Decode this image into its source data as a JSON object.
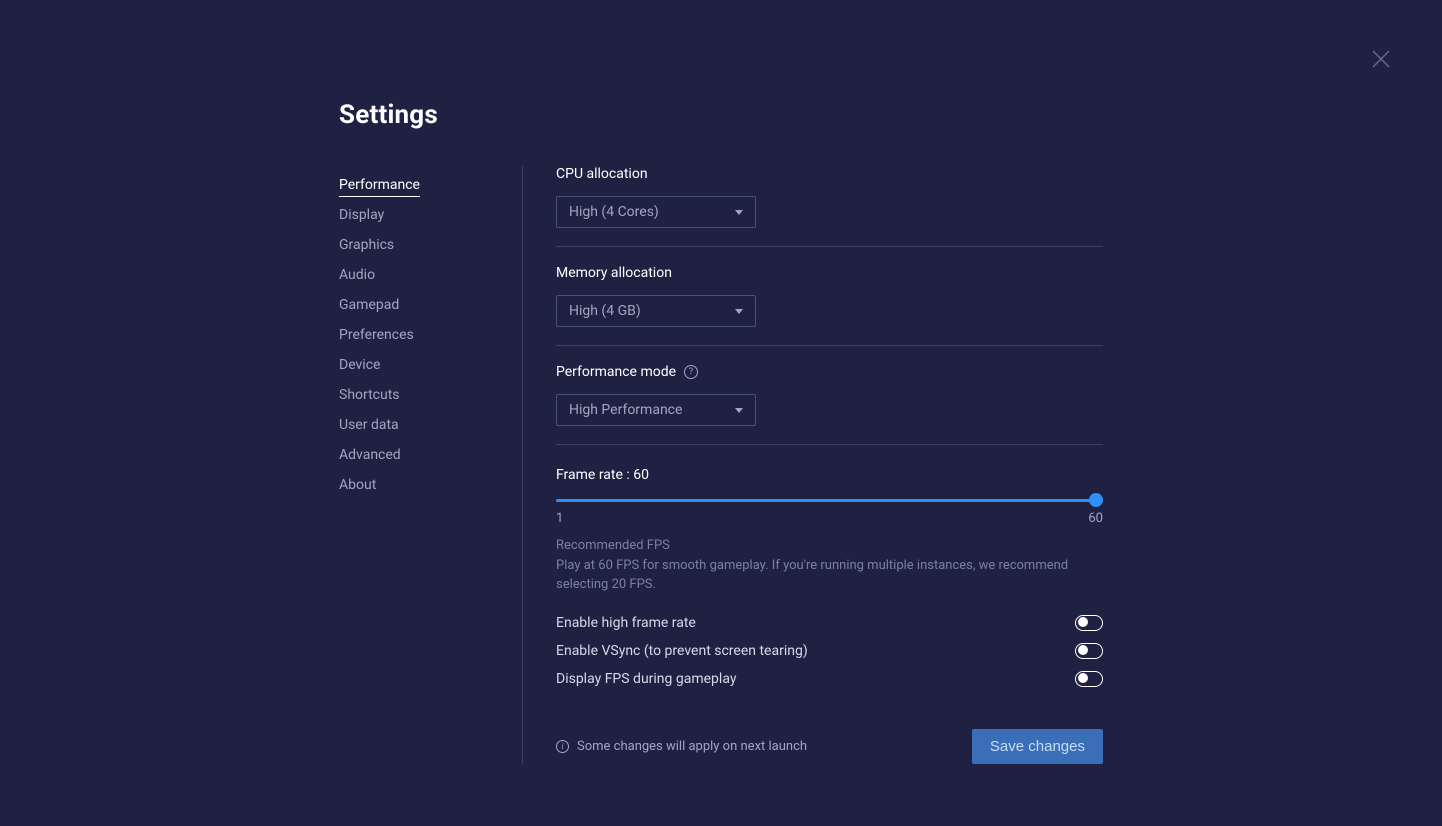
{
  "title": "Settings",
  "sidebar": {
    "items": [
      "Performance",
      "Display",
      "Graphics",
      "Audio",
      "Gamepad",
      "Preferences",
      "Device",
      "Shortcuts",
      "User data",
      "Advanced",
      "About"
    ],
    "active_index": 0
  },
  "cpu": {
    "label": "CPU allocation",
    "value": "High (4 Cores)"
  },
  "memory": {
    "label": "Memory allocation",
    "value": "High (4 GB)"
  },
  "perfmode": {
    "label": "Performance mode",
    "value": "High Performance"
  },
  "framerate": {
    "label_prefix": "Frame rate : ",
    "value": "60",
    "min": "1",
    "max": "60",
    "rec_title": "Recommended FPS",
    "rec_body": "Play at 60 FPS for smooth gameplay. If you're running multiple instances, we recommend selecting 20 FPS."
  },
  "toggles": {
    "high_fps": "Enable high frame rate",
    "vsync": "Enable VSync (to prevent screen tearing)",
    "display_fps": "Display FPS during gameplay"
  },
  "footer": {
    "note": "Some changes will apply on next launch",
    "save": "Save changes"
  }
}
